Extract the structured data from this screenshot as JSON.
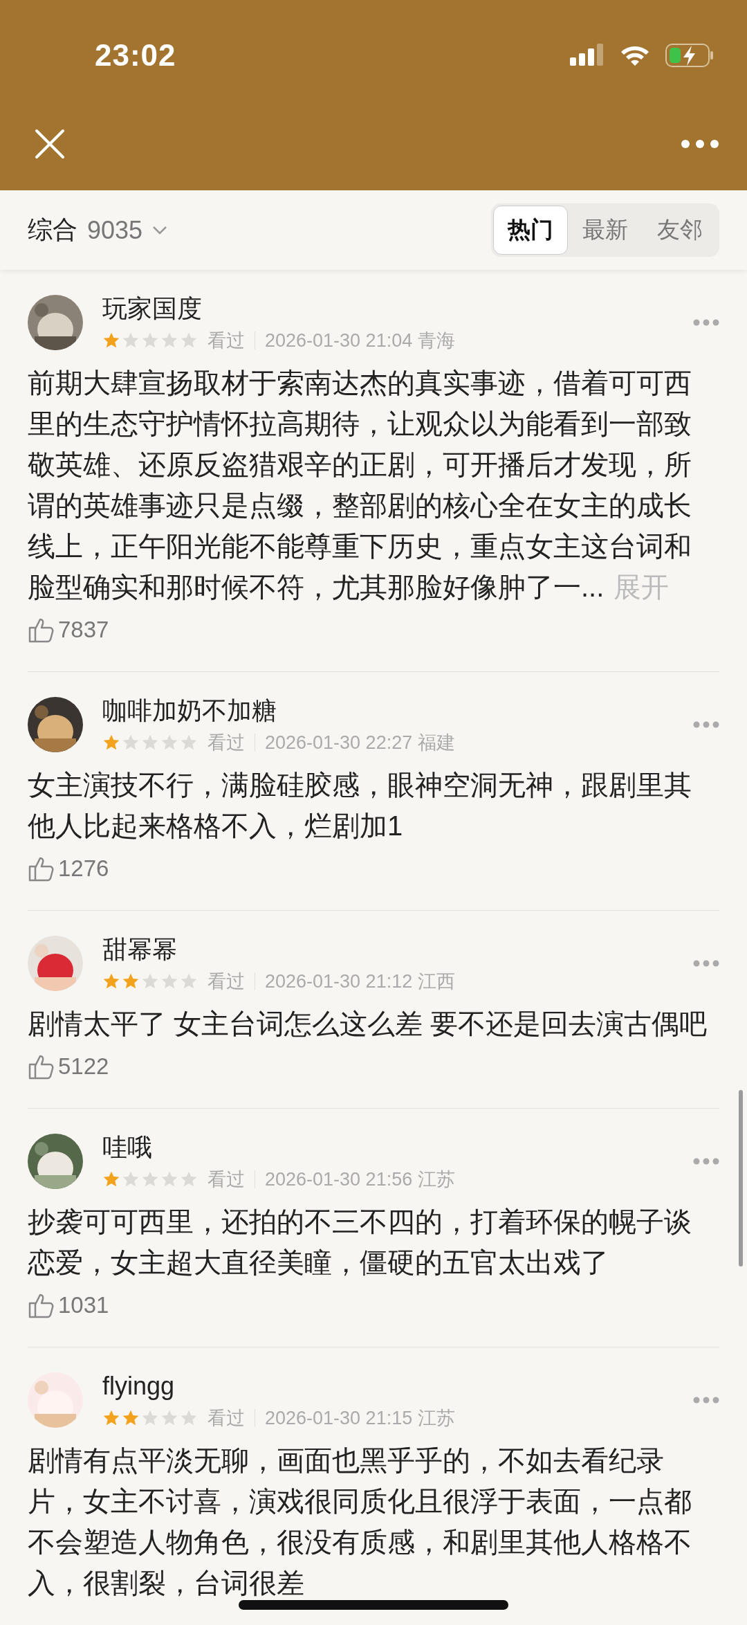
{
  "status_bar": {
    "time": "23:02"
  },
  "filter_bar": {
    "sort_label": "综合",
    "count": "9035",
    "tabs": [
      {
        "label": "热门",
        "selected": true
      },
      {
        "label": "最新",
        "selected": false
      },
      {
        "label": "友邻",
        "selected": false
      }
    ]
  },
  "reviews": [
    {
      "user": "玩家国度",
      "stars": 1,
      "status": "看过",
      "date": "2026-01-30 21:04",
      "location": "青海",
      "text": "前期大肆宣扬取材于索南达杰的真实事迹，借着可可西里的生态守护情怀拉高期待，让观众以为能看到一部致敬英雄、还原反盗猎艰辛的正剧，可开播后才发现，所谓的英雄事迹只是点缀，整部剧的核心全在女主的成长线上，正午阳光能不能尊重下历史，重点女主这台词和脸型确实和那时候不符，尤其那脸好像肿了一...",
      "expand_label": "展开",
      "likes": "7837"
    },
    {
      "user": "咖啡加奶不加糖",
      "stars": 1,
      "status": "看过",
      "date": "2026-01-30 22:27",
      "location": "福建",
      "text": "女主演技不行，满脸硅胶感，眼神空洞无神，跟剧里其他人比起来格格不入，烂剧加1",
      "likes": "1276"
    },
    {
      "user": "甜幂幂",
      "stars": 2,
      "status": "看过",
      "date": "2026-01-30 21:12",
      "location": "江西",
      "text": "剧情太平了 女主台词怎么这么差 要不还是回去演古偶吧",
      "likes": "5122"
    },
    {
      "user": "哇哦",
      "stars": 1,
      "status": "看过",
      "date": "2026-01-30 21:56",
      "location": "江苏",
      "text": "抄袭可可西里，还拍的不三不四的，打着环保的幌子谈恋爱，女主超大直径美瞳，僵硬的五官太出戏了",
      "likes": "1031"
    },
    {
      "user": "flyingg",
      "stars": 2,
      "status": "看过",
      "date": "2026-01-30 21:15",
      "location": "江苏",
      "text": "剧情有点平淡无聊，画面也黑乎乎的，不如去看纪录片，女主不讨喜，演戏很同质化且很浮于表面，一点都不会塑造人物角色，很没有质感，和剧里其他人格格不入，很割裂，台词很差"
    }
  ]
}
